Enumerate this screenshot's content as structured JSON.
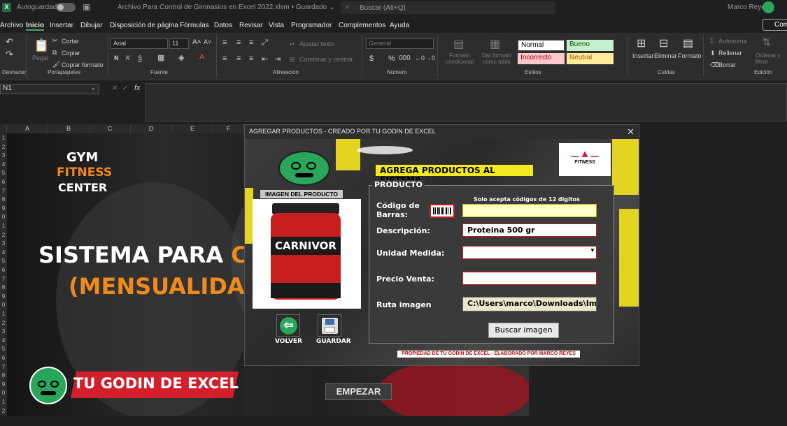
{
  "titlebar": {
    "app_icon": "X",
    "autosave_label": "Autoguardado",
    "file_title": "Archivo Para Control de Gimnasios en Excel 2022.xlsm • Guardado ⌄",
    "search_placeholder": "Buscar (Alt+Q)",
    "user_name": "Marco Reyes"
  },
  "menu": {
    "items": [
      "Archivo",
      "Inicio",
      "Insertar",
      "Dibujar",
      "Disposición de página",
      "Fórmulas",
      "Datos",
      "Revisar",
      "Vista",
      "Programador",
      "Complementos",
      "Ayuda"
    ],
    "comments_button": "Com"
  },
  "ribbon": {
    "undo_group": "Deshacer",
    "clipboard": {
      "paste": "Pegar",
      "cut": "Cortar",
      "copy": "Copiar",
      "format_painter": "Copiar formato",
      "group": "Portapapeles"
    },
    "font": {
      "name": "Arial",
      "size": "11",
      "group": "Fuente"
    },
    "alignment": {
      "wrap": "Ajustar texto",
      "merge": "Combinar y centrar",
      "group": "Alineación"
    },
    "number": {
      "format": "General",
      "group": "Número"
    },
    "styles": {
      "cond": "Formato condicional",
      "table": "Dar formato como tabla",
      "normal": "Normal",
      "good": "Bueno",
      "incorrect": "Incorrecto",
      "neutral": "Neutral",
      "group": "Estilos"
    },
    "cells": {
      "insert": "Insertar",
      "delete": "Eliminar",
      "format": "Formato",
      "group": "Celdas"
    },
    "editing": {
      "autosum": "Autosuma",
      "fill": "Rellenar",
      "clear": "Borrar",
      "sort": "Ordenar y filtrar",
      "group": "Edición"
    }
  },
  "formula_bar": {
    "name_box": "N1",
    "fx": "fx"
  },
  "columns": [
    "A",
    "B",
    "C",
    "D",
    "E",
    "F"
  ],
  "rows": [
    "1",
    "2",
    "3",
    "4",
    "5",
    "6",
    "7",
    "8",
    "9",
    "0",
    "1",
    "2",
    "3",
    "4",
    "5",
    "6",
    "7",
    "8",
    "9",
    "0",
    "1",
    "2",
    "3",
    "4",
    "5",
    "6",
    "7",
    "8",
    "9",
    "0",
    "1",
    "2"
  ],
  "banner": {
    "gym": "GYM",
    "fitness": "FITNESS",
    "center": "CENTER",
    "headline_white": "SISTEMA PARA ",
    "headline_red": "CO",
    "subline": "(MENSUALIDAD",
    "brand": "TU GODIN DE EXCEL",
    "start_button": "EMPEZAR"
  },
  "dialog": {
    "title": "AGREGAR PRODUCTOS - CREADO POR TU GODIN DE EXCEL",
    "close": "✕",
    "header": "AGREGA PRODUCTOS AL SISTEMA",
    "logo_text": "FITNESS",
    "image_caption": "IMAGEN DEL PRODUCTO",
    "product_label": "CARNIVOR",
    "frame_title": "PRODUCTO",
    "barcode_note": "Solo acepta códigos de 12 digitos",
    "labels": {
      "barcode_1": "Código de",
      "barcode_2": "Barras:",
      "description": "Descripción:",
      "unit": "Unidad Medida:",
      "price": "Precio Venta:",
      "path": "Ruta imagen"
    },
    "values": {
      "barcode": "",
      "description": "Proteina 500 gr",
      "unit": "",
      "price": "",
      "path": "C:\\Users\\marco\\Downloads\\Imag"
    },
    "search_button": "Buscar imagen",
    "back_label": "VOLVER",
    "save_label": "GUARDAR",
    "footer": "PROPIEDAD DE TU GODIN DE EXCEL - ELABORADO POR MARCO REYES"
  },
  "colors": {
    "accent_green": "#2aa65c",
    "yellow": "#f2ea1c",
    "red": "#d11f2b",
    "orange": "#f08a1c"
  }
}
